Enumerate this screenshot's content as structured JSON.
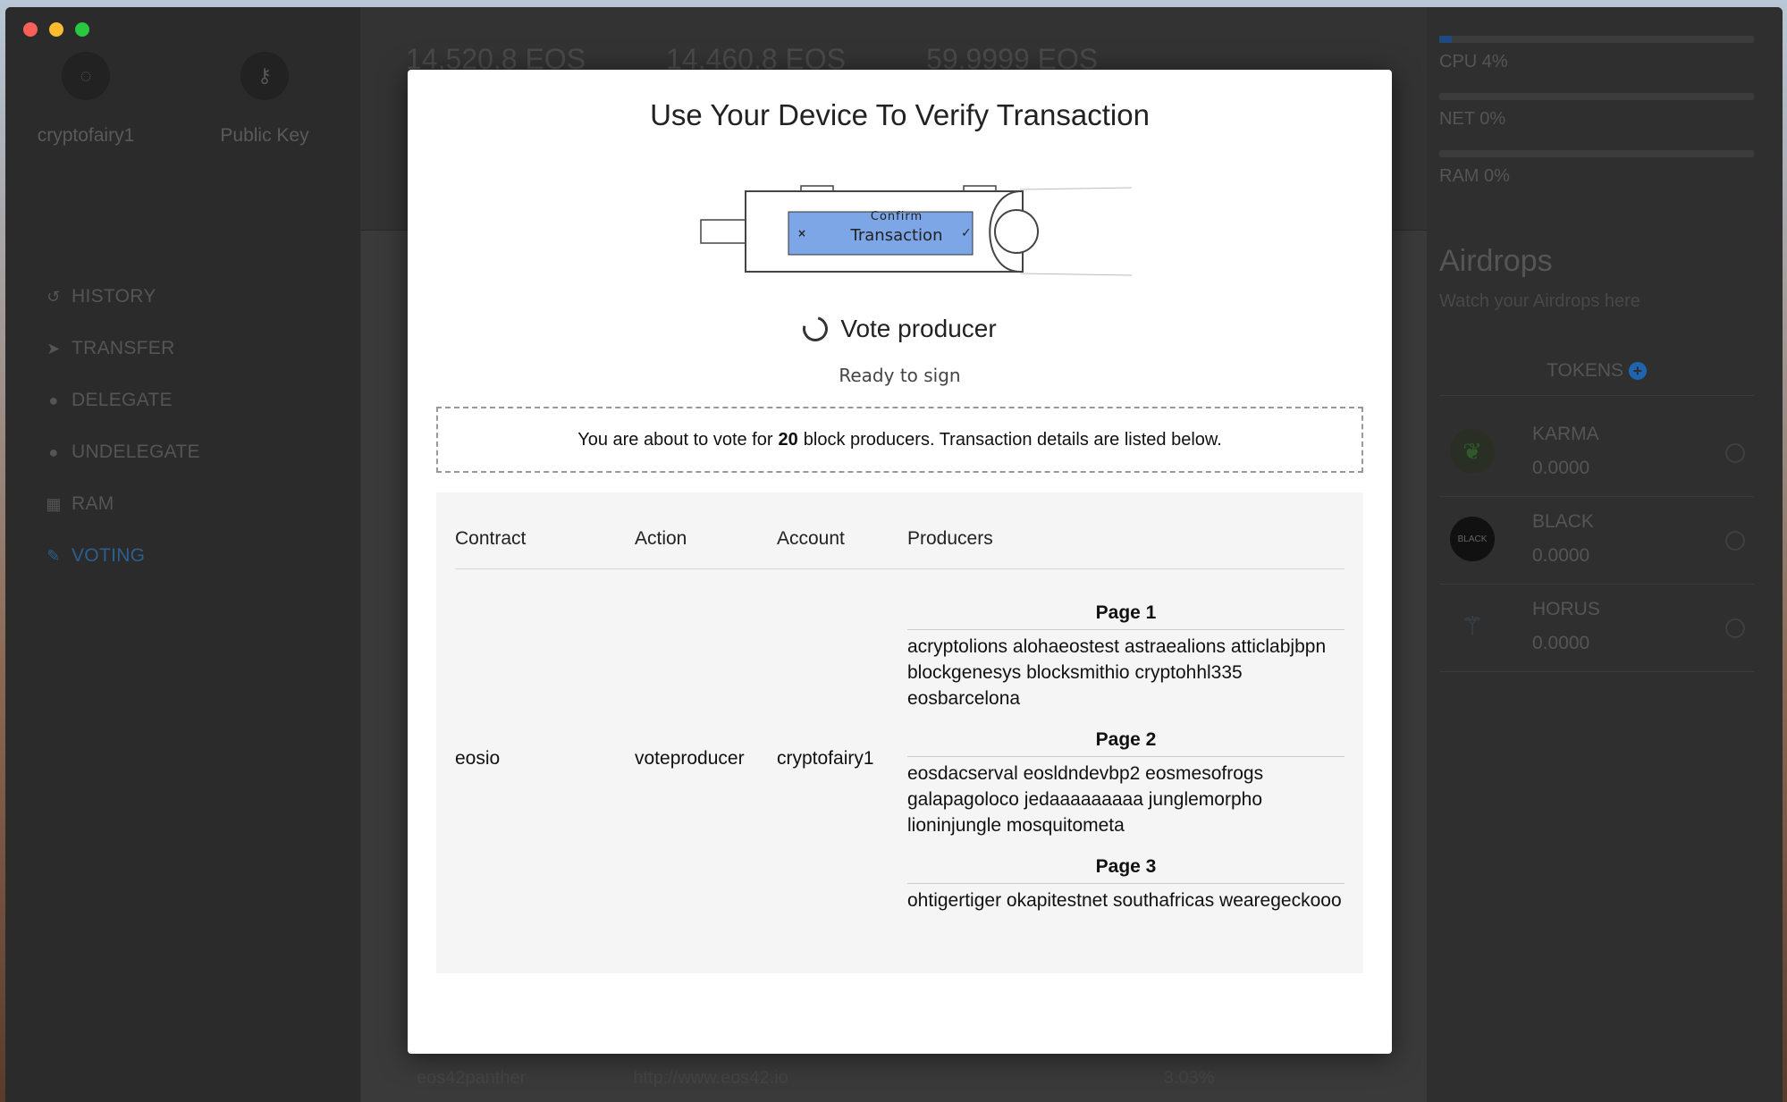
{
  "window": {
    "traffic_lights": [
      "#fc5f57",
      "#fdbc2e",
      "#28c840"
    ]
  },
  "sidebar": {
    "account_name": "cryptofairy1",
    "public_key_label": "Public Key",
    "items": [
      {
        "label": "HISTORY",
        "icon": "history-icon"
      },
      {
        "label": "TRANSFER",
        "icon": "send-icon"
      },
      {
        "label": "DELEGATE",
        "icon": "delegate-icon"
      },
      {
        "label": "UNDELEGATE",
        "icon": "undelegate-icon"
      },
      {
        "label": "RAM",
        "icon": "chip-icon"
      },
      {
        "label": "VOTING",
        "icon": "edit-icon",
        "active": true
      }
    ]
  },
  "balances": [
    "14,520.8 EOS",
    "14,460.8 EOS",
    "59.9999 EOS"
  ],
  "bottom_row": {
    "name": "eos42panther",
    "url": "http://www.eos42.io",
    "pct": "3.03%"
  },
  "resources": [
    {
      "label": "CPU 4%",
      "value": 0.04
    },
    {
      "label": "NET 0%",
      "value": 0
    },
    {
      "label": "RAM 0%",
      "value": 0
    }
  ],
  "airdrops": {
    "title": "Airdrops",
    "subtitle": "Watch your Airdrops here",
    "tokens_label": "TOKENS",
    "tokens": [
      {
        "name": "KARMA",
        "amount": "0.0000"
      },
      {
        "name": "BLACK",
        "amount": "0.0000",
        "logo_text": "BLACK"
      },
      {
        "name": "HORUS",
        "amount": "0.0000"
      }
    ]
  },
  "modal": {
    "title": "Use Your Device To Verify Transaction",
    "device_screen_line1": "Confirm",
    "device_screen_line2": "Transaction",
    "action": "Vote producer",
    "status": "Ready to sign",
    "notice_pre": "You are about to vote for",
    "notice_count": "20",
    "notice_post": "block producers. Transaction details are listed below.",
    "columns": [
      "Contract",
      "Action",
      "Account",
      "Producers"
    ],
    "row": {
      "contract": "eosio",
      "action": "voteproducer",
      "account": "cryptofairy1"
    },
    "pages": [
      {
        "label": "Page 1",
        "producers": "acryptolions alohaeostest astraealions atticlabjbpn blockgenesys blocksmithio cryptohhl335 eosbarcelona"
      },
      {
        "label": "Page 2",
        "producers": "eosdacserval eosldndevbp2 eosmesofrogs galapagoloco jedaaaaaaaaa junglemorpho lioninjungle mosquitometa"
      },
      {
        "label": "Page 3",
        "producers": "ohtigertiger okapitestnet southafricas wearegeckooo"
      }
    ]
  }
}
